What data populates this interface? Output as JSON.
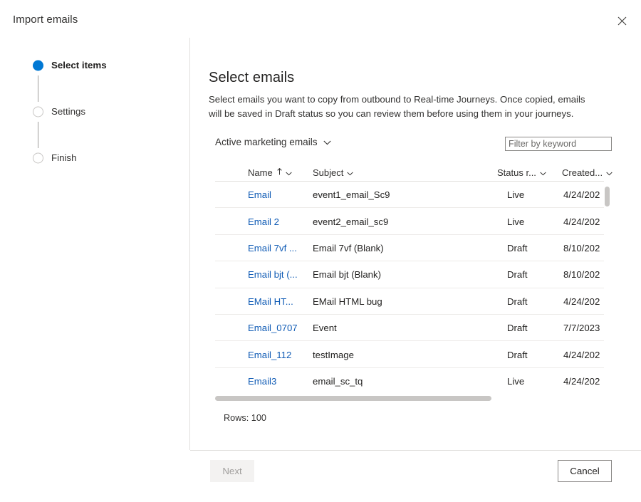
{
  "dialog": {
    "title": "Import emails",
    "close_icon": "close-icon"
  },
  "wizard": {
    "steps": [
      {
        "label": "Select items",
        "state": "current"
      },
      {
        "label": "Settings",
        "state": "upcoming"
      },
      {
        "label": "Finish",
        "state": "upcoming"
      }
    ]
  },
  "pane": {
    "heading": "Select emails",
    "description": "Select emails you want to copy from outbound to Real-time Journeys. Once copied, emails will be saved in Draft status so you can review them before using them in your journeys."
  },
  "toolbar": {
    "view_selector_label": "Active marketing emails",
    "view_selector_icon": "chevron-down-icon",
    "filter_placeholder": "Filter by keyword",
    "filter_value": ""
  },
  "grid": {
    "columns": [
      {
        "label": "Name",
        "sort": "ascending",
        "sort_icon": "arrow-up-icon",
        "menu_icon": "chevron-down-icon"
      },
      {
        "label": "Subject",
        "sort": "none",
        "menu_icon": "chevron-down-icon"
      },
      {
        "label": "Status r...",
        "sort": "none",
        "menu_icon": "chevron-down-icon"
      },
      {
        "label": "Created...",
        "sort": "none",
        "menu_icon": "chevron-down-icon"
      }
    ],
    "rows": [
      {
        "name": "Email",
        "subject": "event1_email_Sc9",
        "status": "Live",
        "created": "4/24/202"
      },
      {
        "name": "Email 2",
        "subject": "event2_email_sc9",
        "status": "Live",
        "created": "4/24/202"
      },
      {
        "name": "Email 7vf ...",
        "subject": "Email 7vf (Blank)",
        "status": "Draft",
        "created": "8/10/202"
      },
      {
        "name": "Email bjt (...",
        "subject": "Email bjt (Blank)",
        "status": "Draft",
        "created": "8/10/202"
      },
      {
        "name": "EMail HT...",
        "subject": "EMail HTML bug",
        "status": "Draft",
        "created": "4/24/202"
      },
      {
        "name": "Email_0707",
        "subject": "Event",
        "status": "Draft",
        "created": "7/7/2023"
      },
      {
        "name": "Email_112",
        "subject": "testImage",
        "status": "Draft",
        "created": "4/24/202"
      },
      {
        "name": "Email3",
        "subject": "email_sc_tq",
        "status": "Live",
        "created": "4/24/202"
      }
    ],
    "rows_count_label": "Rows: 100"
  },
  "footer": {
    "next_label": "Next",
    "cancel_label": "Cancel"
  },
  "colors": {
    "accent": "#0078d4",
    "link": "#0f5bb5",
    "border": "#e1dfdd",
    "scrollbar": "#c8c6c4"
  }
}
